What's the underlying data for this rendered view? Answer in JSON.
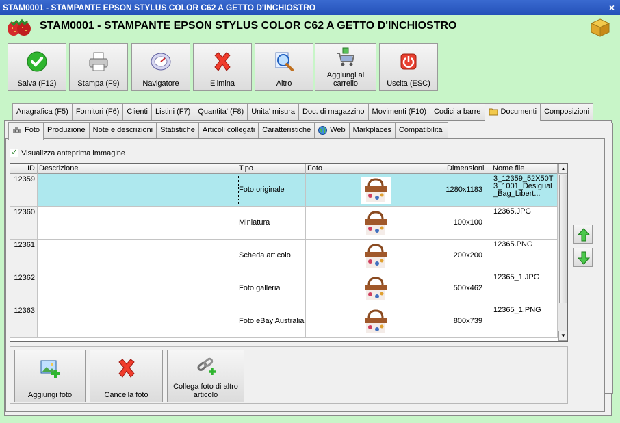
{
  "window": {
    "title": "STAM0001 - STAMPANTE EPSON STYLUS COLOR C62 A GETTO D'INCHIOSTRO",
    "close_symbol": "×"
  },
  "header": {
    "title": "STAM0001 - STAMPANTE EPSON STYLUS COLOR C62 A GETTO D'INCHIOSTRO"
  },
  "toolbar": {
    "save": "Salva (F12)",
    "print": "Stampa (F9)",
    "navigator": "Navigatore",
    "delete": "Elimina",
    "other": "Altro",
    "add_to_cart": "Aggiungi al carrello",
    "exit": "Uscita (ESC)"
  },
  "tabs_main": [
    "Anagrafica (F5)",
    "Fornitori (F6)",
    "Clienti",
    "Listini (F7)",
    "Quantita' (F8)",
    "Unita' misura",
    "Doc. di magazzino",
    "Movimenti (F10)",
    "Codici a barre",
    "Documenti",
    "Composizioni"
  ],
  "tabs_sub": [
    "Foto",
    "Produzione",
    "Note e descrizioni",
    "Statistiche",
    "Articoli collegati",
    "Caratteristiche",
    "Web",
    "Markplaces",
    "Compatibilita'"
  ],
  "preview_checkbox": {
    "label": "Visualizza anteprima immagine",
    "checked": true
  },
  "grid": {
    "columns": [
      "ID",
      "Descrizione",
      "Tipo",
      "Foto",
      "Dimensioni",
      "Nome file"
    ],
    "rows": [
      {
        "id": "12359",
        "descrizione": "",
        "tipo": "Foto originale",
        "dimensioni": "1280x1183",
        "nome_file": "3_12359_52X50T3_1001_Desigual_Bag_Libert..."
      },
      {
        "id": "12360",
        "descrizione": "",
        "tipo": "Miniatura",
        "dimensioni": "100x100",
        "nome_file": "12365.JPG"
      },
      {
        "id": "12361",
        "descrizione": "",
        "tipo": "Scheda articolo",
        "dimensioni": "200x200",
        "nome_file": "12365.PNG"
      },
      {
        "id": "12362",
        "descrizione": "",
        "tipo": "Foto galleria",
        "dimensioni": "500x462",
        "nome_file": "12365_1.JPG"
      },
      {
        "id": "12363",
        "descrizione": "",
        "tipo": "Foto eBay Australia",
        "dimensioni": "800x739",
        "nome_file": "12365_1.PNG"
      }
    ],
    "selected_row": 0
  },
  "bottom_buttons": {
    "add_photo": "Aggiungi foto",
    "delete_photo": "Cancella foto",
    "link_photo": "Collega foto di altro articolo"
  },
  "colors": {
    "background": "#c8f5c8",
    "titlebar": "#2450b8",
    "selected_row": "#aee8ee"
  }
}
